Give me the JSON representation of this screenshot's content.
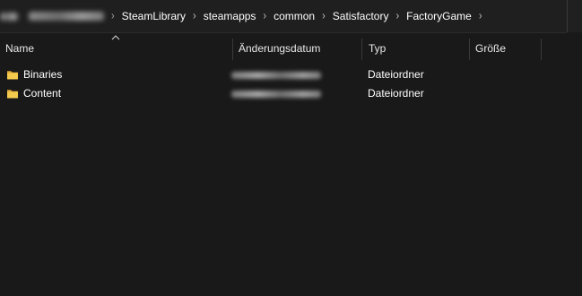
{
  "address_bar": {
    "path_segments": [
      "SteamLibrary",
      "steamapps",
      "common",
      "Satisfactory",
      "FactoryGame"
    ],
    "separator_icon": "chevron-right-icon"
  },
  "columns": {
    "name": "Name",
    "date_modified": "Änderungsdatum",
    "type": "Typ",
    "size": "Größe",
    "sort_indicator": "sort-ascending-icon"
  },
  "files": [
    {
      "name": "Binaries",
      "type": "Dateiordner",
      "icon": "folder-icon"
    },
    {
      "name": "Content",
      "type": "Dateiordner",
      "icon": "folder-icon"
    }
  ],
  "colors": {
    "background": "#191919",
    "address_bar_bg": "#1f1f1f",
    "text": "#ffffff",
    "folder_yellow": "#f3c94e",
    "divider": "#3a3a3a"
  }
}
